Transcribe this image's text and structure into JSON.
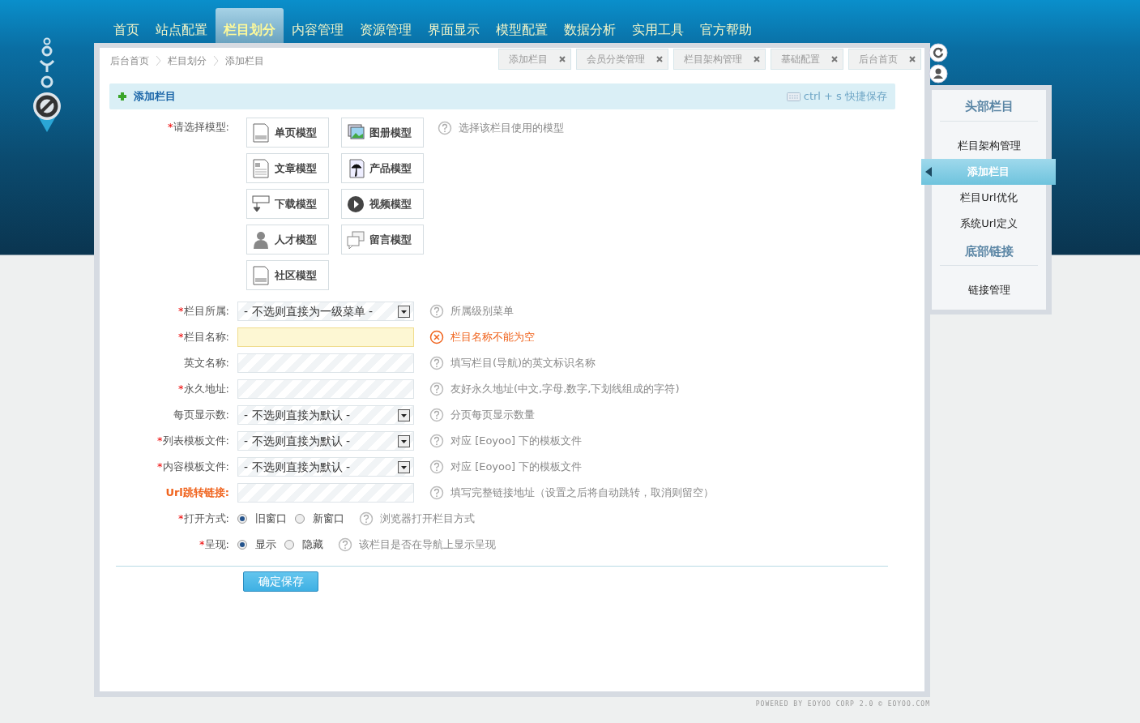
{
  "nav": [
    {
      "label": "首页",
      "selected": false
    },
    {
      "label": "站点配置",
      "selected": false
    },
    {
      "label": "栏目划分",
      "selected": true
    },
    {
      "label": "内容管理",
      "selected": false
    },
    {
      "label": "资源管理",
      "selected": false
    },
    {
      "label": "界面显示",
      "selected": false
    },
    {
      "label": "模型配置",
      "selected": false
    },
    {
      "label": "数据分析",
      "selected": false
    },
    {
      "label": "实用工具",
      "selected": false
    },
    {
      "label": "官方帮助",
      "selected": false
    }
  ],
  "breadcrumb": [
    "后台首页",
    "栏目划分",
    "添加栏目"
  ],
  "open_tabs": [
    {
      "label": "添加栏目"
    },
    {
      "label": "会员分类管理"
    },
    {
      "label": "栏目架构管理"
    },
    {
      "label": "基础配置"
    },
    {
      "label": "后台首页"
    }
  ],
  "panel_title": "添加栏目",
  "shortcut_hint": "ctrl + s 快捷保存",
  "model_field": {
    "required_mark": "*",
    "label": "请选择模型:",
    "hint": "选择该栏目使用的模型",
    "models": [
      {
        "label": "单页模型",
        "kind": "page"
      },
      {
        "label": "图册模型",
        "kind": "gallery"
      },
      {
        "label": "文章模型",
        "kind": "article"
      },
      {
        "label": "产品模型",
        "kind": "product"
      },
      {
        "label": "下载模型",
        "kind": "download"
      },
      {
        "label": "视频模型",
        "kind": "video"
      },
      {
        "label": "人才模型",
        "kind": "person"
      },
      {
        "label": "留言模型",
        "kind": "message"
      },
      {
        "label": "社区模型",
        "kind": "page"
      }
    ]
  },
  "fields": [
    {
      "kind": "select",
      "required_mark": "*",
      "label": "栏目所属:",
      "value": "- 不选则直接为一级菜单 -",
      "hint": "所属级别菜单"
    },
    {
      "kind": "text",
      "required_mark": "*",
      "label": "栏目名称:",
      "error": true,
      "hint": "栏目名称不能为空"
    },
    {
      "kind": "text",
      "label": "英文名称:",
      "error": false,
      "hint": "填写栏目(导航)的英文标识名称"
    },
    {
      "kind": "text",
      "required_mark": "*",
      "label": "永久地址:",
      "error": false,
      "hint": "友好永久地址(中文,字母,数字,下划线组成的字符)"
    },
    {
      "kind": "select",
      "label": "每页显示数:",
      "value": "- 不选则直接为默认 -",
      "hint": "分页每页显示数量"
    },
    {
      "kind": "select",
      "required_mark": "*",
      "label": "列表模板文件:",
      "value": "- 不选则直接为默认 -",
      "hint": "对应 [Eoyoo] 下的模板文件"
    },
    {
      "kind": "select",
      "required_mark": "*",
      "label": "内容模板文件:",
      "value": "- 不选则直接为默认 -",
      "hint": "对应 [Eoyoo] 下的模板文件"
    },
    {
      "kind": "text",
      "label": "Url跳转链接:",
      "emphasized": true,
      "error": false,
      "hint": "填写完整链接地址（设置之后将自动跳转，取消则留空）"
    },
    {
      "kind": "radio",
      "required_mark": "*",
      "label": "打开方式:",
      "options": [
        {
          "label": "旧窗口",
          "selected": true
        },
        {
          "label": "新窗口",
          "selected": false
        }
      ],
      "hint": "浏览器打开栏目方式"
    },
    {
      "kind": "radio",
      "required_mark": "*",
      "label": "呈现:",
      "options": [
        {
          "label": "显示",
          "selected": true
        },
        {
          "label": "隐藏",
          "selected": false
        }
      ],
      "hint": "该栏目是否在导航上显示呈现"
    }
  ],
  "save_button": "确定保存",
  "sidebar": [
    {
      "title": "头部栏目",
      "items": [
        {
          "label": "栏目架构管理",
          "selected": false
        },
        {
          "label": "添加栏目",
          "selected": true
        },
        {
          "label": "栏目Url优化",
          "selected": false
        },
        {
          "label": "系统Url定义",
          "selected": false
        }
      ]
    },
    {
      "title": "底部链接",
      "items": [
        {
          "label": "链接管理",
          "selected": false
        }
      ]
    }
  ],
  "footer": "POWERED BY EOYOO CORP 2.0 © EOYOO.COM"
}
